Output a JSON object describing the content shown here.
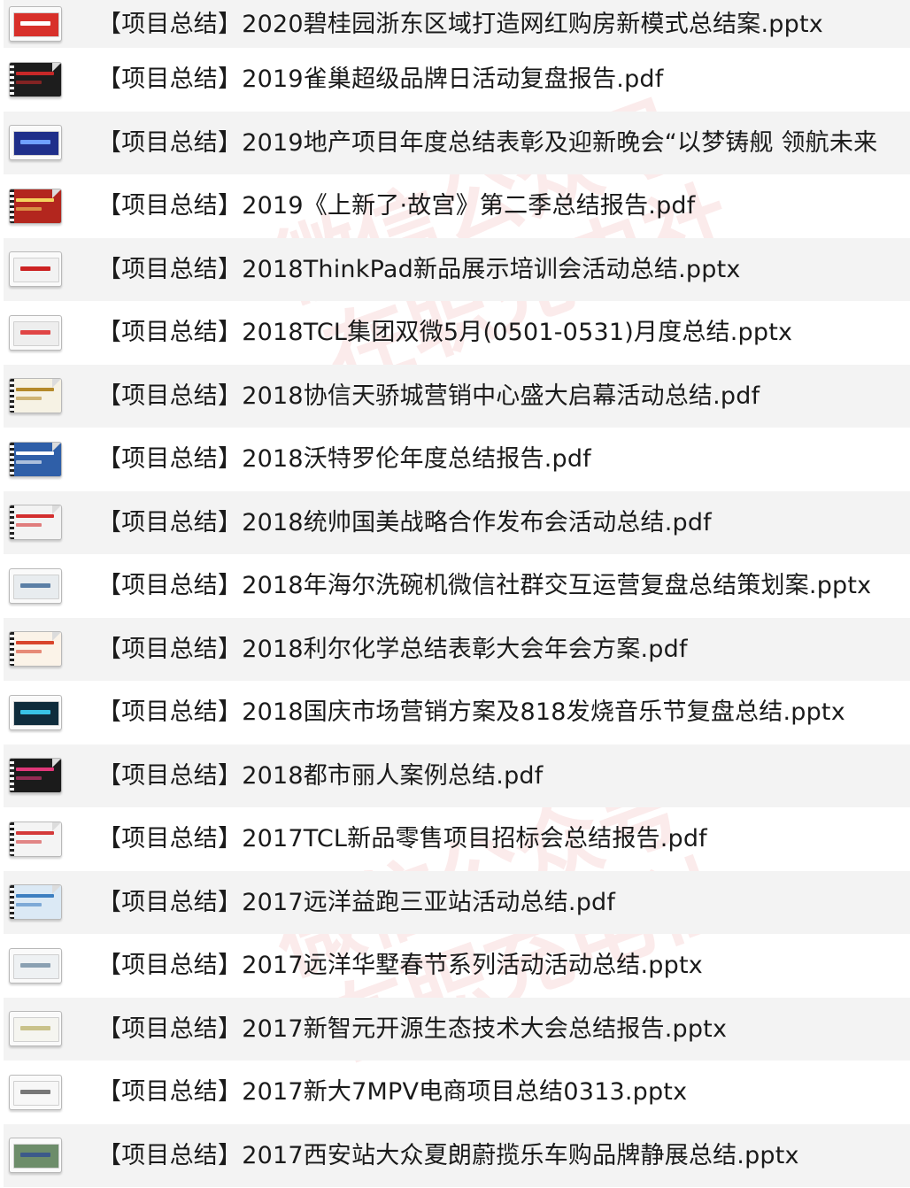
{
  "files": [
    {
      "name": "【项目总结】2020碧桂园浙东区域打造网红购房新模式总结案.pptx",
      "thumb_style": "slide",
      "thumb_color": "#d8302a",
      "thumb_accent": "#ffffff"
    },
    {
      "name": "【项目总结】2019雀巢超级品牌日活动复盘报告.pdf",
      "thumb_style": "doc",
      "thumb_color": "#1d1d1d",
      "thumb_accent": "#c62828"
    },
    {
      "name": "【项目总结】2019地产项目年度总结表彰及迎新晚会“以梦铸舰  领航未来",
      "thumb_style": "slide",
      "thumb_color": "#1f2f8a",
      "thumb_accent": "#6fa0ff"
    },
    {
      "name": "【项目总结】2019《上新了·故宫》第二季总结报告.pdf",
      "thumb_style": "doc",
      "thumb_color": "#b3261e",
      "thumb_accent": "#f4d35e"
    },
    {
      "name": "【项目总结】2018ThinkPad新品展示培训会活动总结.pptx",
      "thumb_style": "slide",
      "thumb_color": "#f2f2f2",
      "thumb_accent": "#cc2222"
    },
    {
      "name": "【项目总结】2018TCL集团双微5月(0501-0531)月度总结.pptx",
      "thumb_style": "slide",
      "thumb_color": "#eeeeee",
      "thumb_accent": "#e04545"
    },
    {
      "name": "【项目总结】2018协信天骄城营销中心盛大启幕活动总结.pdf",
      "thumb_style": "doc",
      "thumb_color": "#f6f2e4",
      "thumb_accent": "#b58a2a"
    },
    {
      "name": "【项目总结】2018沃特罗伦年度总结报告.pdf",
      "thumb_style": "doc",
      "thumb_color": "#2f5fa8",
      "thumb_accent": "#ffffff"
    },
    {
      "name": "【项目总结】2018统帅国美战略合作发布会活动总结.pdf",
      "thumb_style": "doc",
      "thumb_color": "#f3f3f3",
      "thumb_accent": "#d32f2f"
    },
    {
      "name": "【项目总结】2018年海尔洗碗机微信社群交互运营复盘总结策划案.pptx",
      "thumb_style": "slide",
      "thumb_color": "#e8ecef",
      "thumb_accent": "#5b7fa6"
    },
    {
      "name": "【项目总结】2018利尔化学总结表彰大会年会方案.pdf",
      "thumb_style": "doc",
      "thumb_color": "#fbf3e8",
      "thumb_accent": "#d9452b"
    },
    {
      "name": "【项目总结】2018国庆市场营销方案及818发烧音乐节复盘总结.pptx",
      "thumb_style": "slide",
      "thumb_color": "#0f2c3c",
      "thumb_accent": "#39c3e6"
    },
    {
      "name": "【项目总结】2018都市丽人案例总结.pdf",
      "thumb_style": "doc",
      "thumb_color": "#1b1b1b",
      "thumb_accent": "#e2387a"
    },
    {
      "name": "【项目总结】2017TCL新品零售项目招标会总结报告.pdf",
      "thumb_style": "doc",
      "thumb_color": "#f4f4f4",
      "thumb_accent": "#d43a3a"
    },
    {
      "name": "【项目总结】2017远洋益跑三亚站活动总结.pdf",
      "thumb_style": "doc",
      "thumb_color": "#dbe9f5",
      "thumb_accent": "#3d7fc1"
    },
    {
      "name": "【项目总结】2017远洋华墅春节系列活动活动总结.pptx",
      "thumb_style": "slide",
      "thumb_color": "#eef1f3",
      "thumb_accent": "#8aa0b2"
    },
    {
      "name": "【项目总结】2017新智元开源生态技术大会总结报告.pptx",
      "thumb_style": "slide",
      "thumb_color": "#f5f5f0",
      "thumb_accent": "#c9c28a"
    },
    {
      "name": "【项目总结】2017新大7MPV电商项目总结0313.pptx",
      "thumb_style": "slide",
      "thumb_color": "#f7f7f7",
      "thumb_accent": "#777777"
    },
    {
      "name": "【项目总结】2017西安站大众夏朗蔚揽乐车购品牌静展总结.pptx",
      "thumb_style": "slide",
      "thumb_color": "#6d8d6a",
      "thumb_accent": "#3c5a8a"
    }
  ],
  "watermark": {
    "line1": "微信公众号",
    "line2": "在职充电社"
  }
}
